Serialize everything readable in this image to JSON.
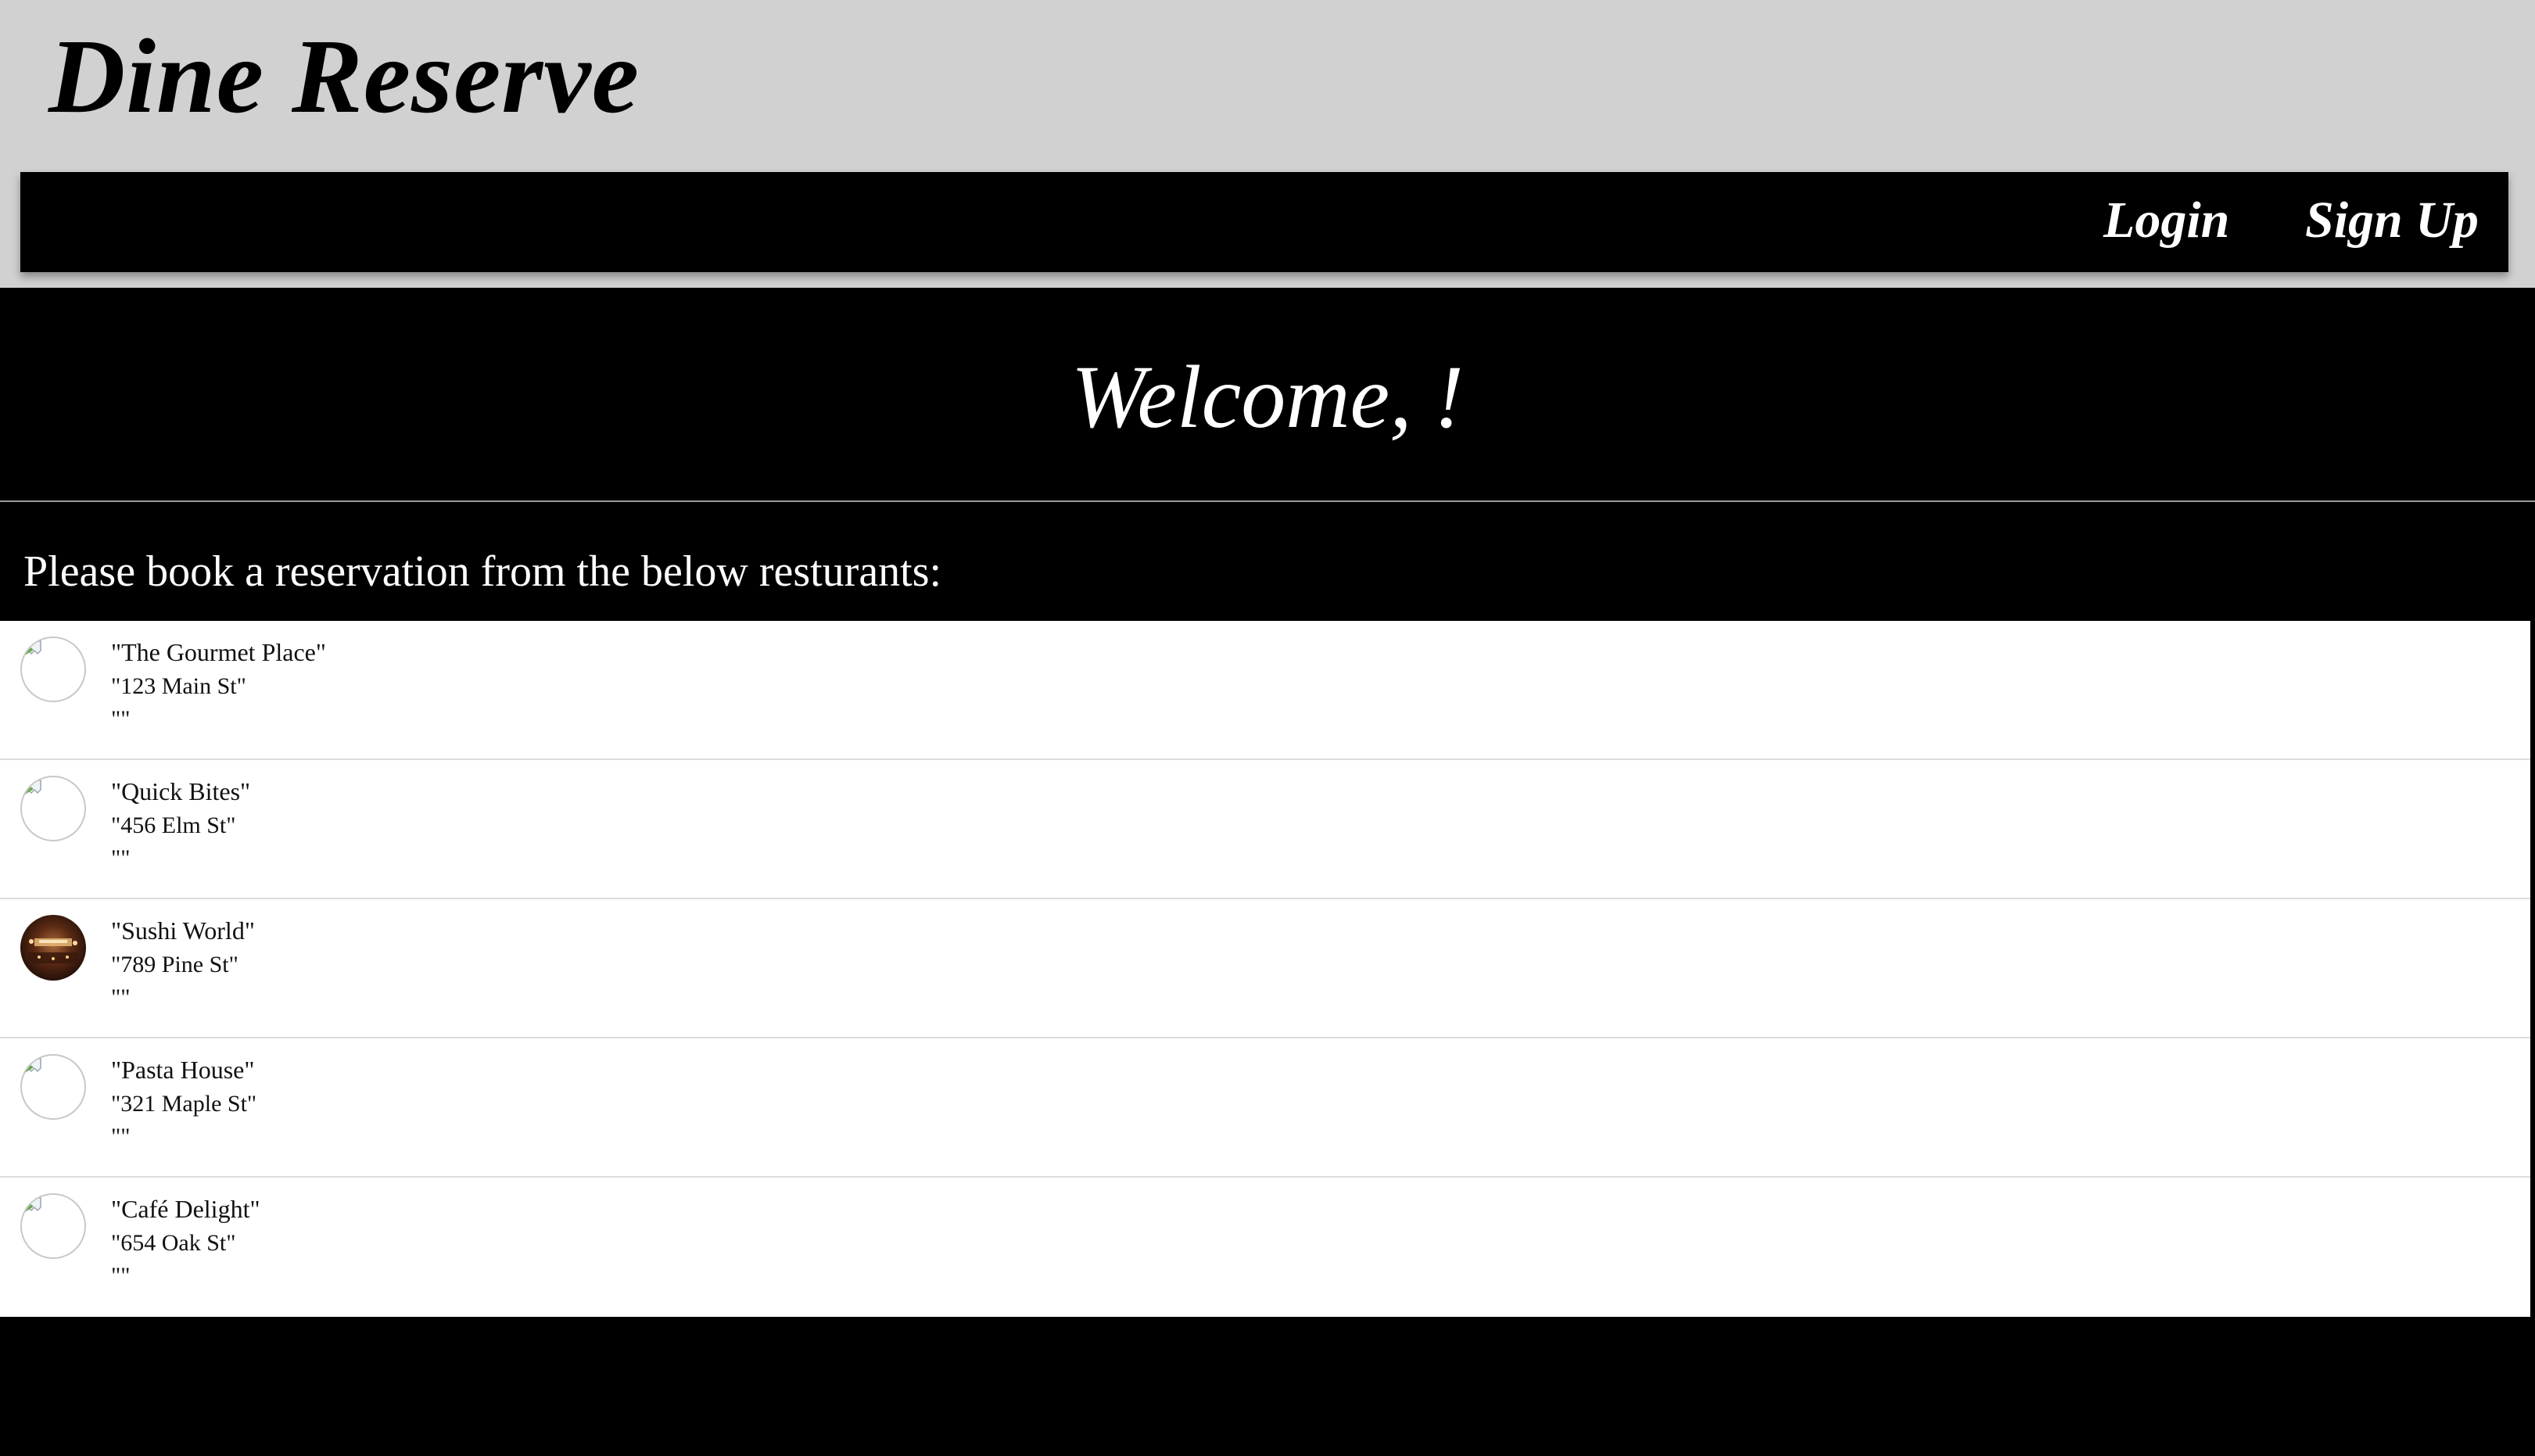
{
  "header": {
    "brand": "Dine Reserve",
    "nav": {
      "login_label": "Login",
      "signup_label": "Sign Up"
    }
  },
  "welcome": {
    "text": "Welcome, !"
  },
  "reservations": {
    "prompt": "Please book a reservation from the below resturants:",
    "restaurants": [
      {
        "name": "\"The Gourmet Place\"",
        "address": "\"123 Main St\"",
        "note": "\"\"",
        "image": "broken-image-icon"
      },
      {
        "name": "\"Quick Bites\"",
        "address": "\"456 Elm St\"",
        "note": "\"\"",
        "image": "broken-image-icon"
      },
      {
        "name": "\"Sushi World\"",
        "address": "\"789 Pine St\"",
        "note": "\"\"",
        "image": "restaurant-photo"
      },
      {
        "name": "\"Pasta House\"",
        "address": "\"321 Maple St\"",
        "note": "\"\"",
        "image": "broken-image-icon"
      },
      {
        "name": "\"Café Delight\"",
        "address": "\"654 Oak St\"",
        "note": "\"\"",
        "image": "broken-image-icon"
      }
    ]
  },
  "colors": {
    "header_bg": "#d1d1d1",
    "nav_bg": "#000000",
    "page_bg": "#000000",
    "list_bg": "#ffffff",
    "nav_text": "#ffffff"
  }
}
